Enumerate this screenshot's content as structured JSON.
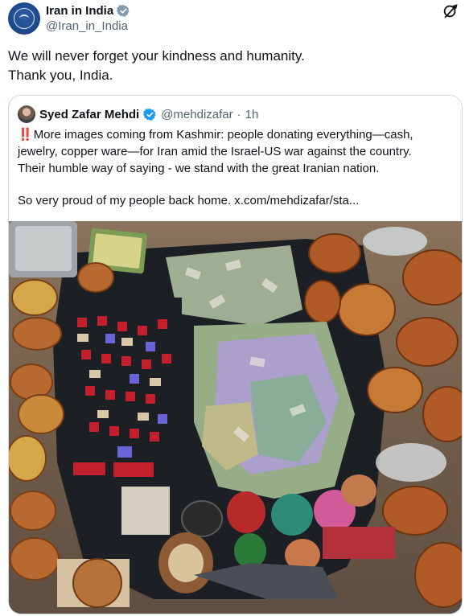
{
  "post": {
    "author_name": "Iran in India",
    "author_handle": "@Iran_in_India",
    "author_verified": true,
    "text_lines": [
      "We will never forget your kindness and humanity.",
      "Thank you, India."
    ]
  },
  "quoted": {
    "author_name": "Syed Zafar Mehdi",
    "author_handle": "@mehdizafar",
    "separator": "·",
    "time": "1h",
    "emoji": "‼️",
    "text_lines": [
      "More images coming from Kashmir: people donating everything—cash,",
      "jewelry, copper ware—for Iran amid the Israel-US war against the country.",
      "Their humble way of saying - we stand with the great Iranian nation."
    ],
    "text_line_2": "So very proud of my people back home.  x.com/mehdizafar/sta...",
    "photo_icon": "donations-photo"
  },
  "icons": {
    "verified": "verified-badge-icon",
    "grok": "grok-icon"
  },
  "colors": {
    "verified_blue": "#1d9bf0",
    "text_primary": "#0f1419",
    "text_secondary": "#536471",
    "border": "#cfd9de"
  }
}
